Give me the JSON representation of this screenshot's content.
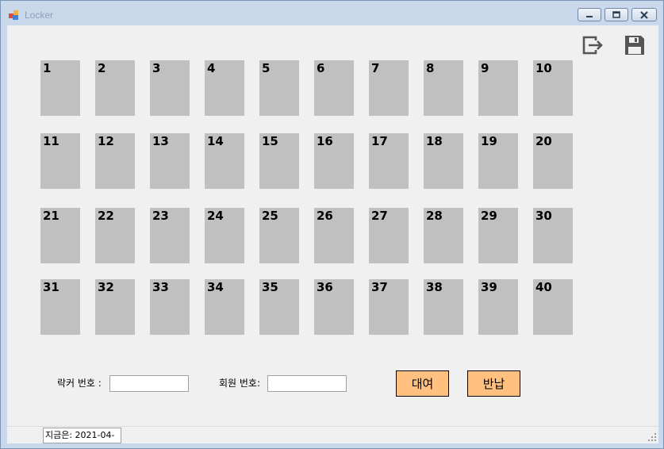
{
  "window": {
    "title": "Locker"
  },
  "toolbar": {
    "exit_icon": "exit-icon",
    "save_icon": "save-icon"
  },
  "lockers": [
    "1",
    "2",
    "3",
    "4",
    "5",
    "6",
    "7",
    "8",
    "9",
    "10",
    "11",
    "12",
    "13",
    "14",
    "15",
    "16",
    "17",
    "18",
    "19",
    "20",
    "21",
    "22",
    "23",
    "24",
    "25",
    "26",
    "27",
    "28",
    "29",
    "30",
    "31",
    "32",
    "33",
    "34",
    "35",
    "36",
    "37",
    "38",
    "39",
    "40"
  ],
  "form": {
    "locker_label": "락커 번호 :",
    "locker_value": "",
    "member_label": "회원 번호:",
    "member_value": "",
    "rent_label": "대여",
    "return_label": "반납"
  },
  "status": {
    "text": "지금은: 2021-04-"
  },
  "colors": {
    "locker": "#c0c0c0",
    "button": "#ffc080",
    "client": "#f0f0f0",
    "frame": "#c9d8eb"
  }
}
